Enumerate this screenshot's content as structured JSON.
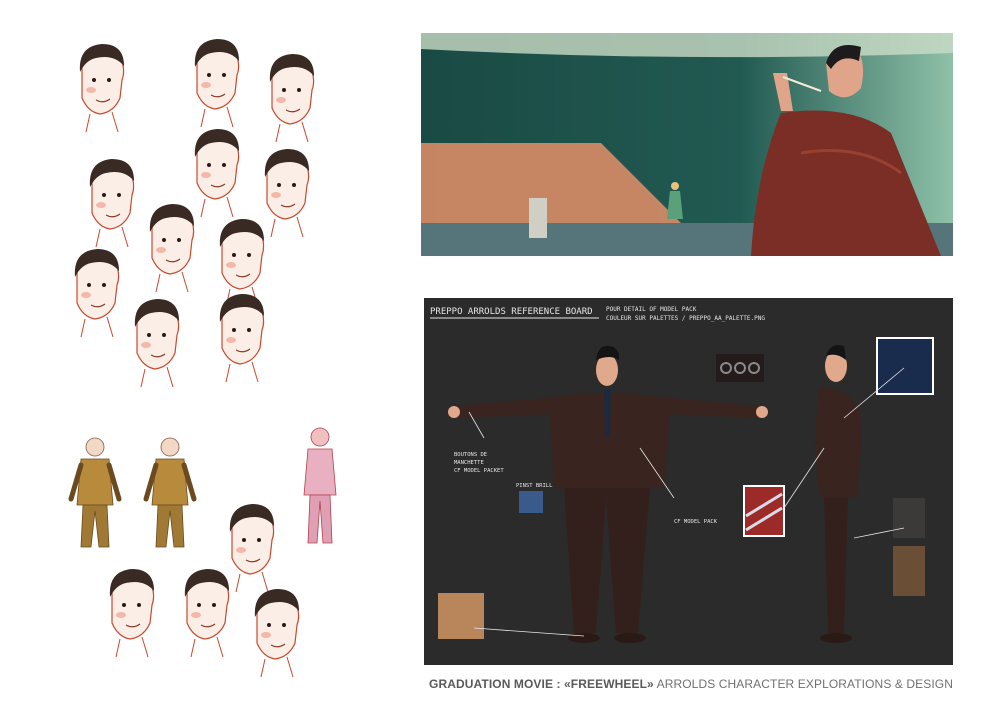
{
  "reference_board": {
    "title": "PREPPO ARROLDS   REFERENCE BOARD",
    "note_line1": "POUR DETAIL OF MODEL PACK",
    "note_line2": "COULEUR SUR PALETTES / PREPPO_AA_PALETTE.PNG",
    "annotation_buttons_1": "BOUTONS DE",
    "annotation_buttons_2": "MANCHETTE",
    "annotation_buttons_3": "CF MODEL PACKET",
    "annotation_pin": "PINST BRILL",
    "annotation_model": "CF MODEL PACK"
  },
  "caption": {
    "bold": "GRADUATION MOVIE : «FREEWHEEL»",
    "rest": " ARROLDS CHARACTER EXPLORATIONS & DESIGN"
  },
  "colors": {
    "board_bg": "#2b2b2b",
    "still_teal": "#1f4a42",
    "suit_red": "#6b2a22",
    "sketch_red": "#c9492f"
  }
}
